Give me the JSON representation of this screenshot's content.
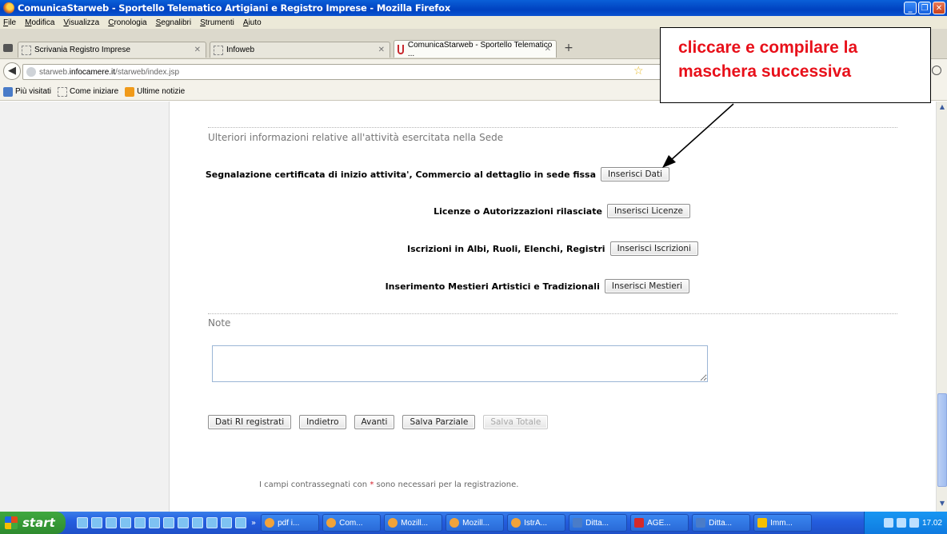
{
  "window": {
    "title": "ComunicaStarweb - Sportello Telematico Artigiani e Registro Imprese - Mozilla Firefox"
  },
  "menu": [
    "File",
    "Modifica",
    "Visualizza",
    "Cronologia",
    "Segnalibri",
    "Strumenti",
    "Aiuto"
  ],
  "tabs": [
    {
      "label": "Scrivania Registro Imprese"
    },
    {
      "label": "Infoweb"
    },
    {
      "label": "ComunicaStarweb - Sportello Telematico ..."
    }
  ],
  "nav": {
    "url_prefix": "starweb.",
    "url_domain": "infocamere.it",
    "url_path": "/starweb/index.jsp"
  },
  "bookmarks": [
    "Più visitati",
    "Come iniziare",
    "Ultime notizie"
  ],
  "form": {
    "section1_title": "Ulteriori informazioni relative all'attività esercitata nella Sede",
    "rows": [
      {
        "label": "Segnalazione certificata di inizio attivita', Commercio al dettaglio in sede fissa",
        "button": "Inserisci Dati"
      },
      {
        "label": "Licenze o Autorizzazioni rilasciate",
        "button": "Inserisci Licenze"
      },
      {
        "label": "Iscrizioni in Albi, Ruoli, Elenchi, Registri",
        "button": "Inserisci Iscrizioni"
      },
      {
        "label": "Inserimento Mestieri Artistici e Tradizionali",
        "button": "Inserisci Mestieri"
      }
    ],
    "note_title": "Note",
    "buttons": {
      "dati_ri": "Dati RI registrati",
      "indietro": "Indietro",
      "avanti": "Avanti",
      "salva_parziale": "Salva Parziale",
      "salva_totale": "Salva Totale"
    },
    "footnote_before": "I campi contrassegnati con",
    "footnote_star": "*",
    "footnote_after": "sono necessari per la registrazione."
  },
  "annotation": {
    "line1": "cliccare e compilare la",
    "line2": "maschera successiva"
  },
  "taskbar": {
    "start": "start",
    "more": "»",
    "tasks": [
      "pdf i...",
      "Com...",
      "Mozill...",
      "Mozill...",
      "IstrA...",
      "Ditta...",
      "AGE...",
      "Ditta...",
      "Imm..."
    ],
    "clock": "17.02"
  }
}
